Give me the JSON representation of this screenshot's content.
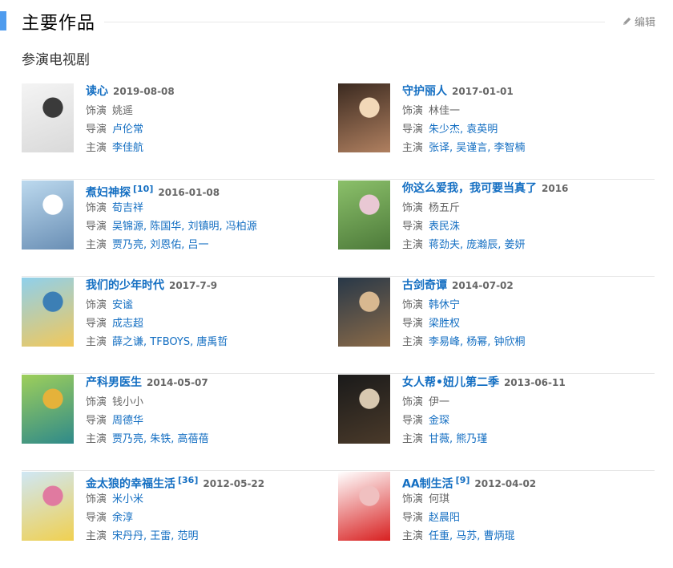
{
  "section": {
    "title": "主要作品",
    "edit_label": "编辑",
    "subtitle": "参演电视剧"
  },
  "labels": {
    "role": "饰演",
    "director": "导演",
    "cast": "主演"
  },
  "works": [
    {
      "title": "读心",
      "ref": "",
      "date": "2019-08-08",
      "role": "姚遥",
      "role_link": false,
      "director": "卢伦常",
      "cast": "李佳航",
      "poster_colors": [
        "#f4f4f4",
        "#d9d9d9",
        "#3a3a3a"
      ]
    },
    {
      "title": "守护丽人",
      "ref": "",
      "date": "2017-01-01",
      "role": "林佳一",
      "role_link": false,
      "director": "朱少杰, 袁英明",
      "cast": "张译, 吴谨言, 李智楠",
      "poster_colors": [
        "#3b2a20",
        "#b08060",
        "#f2d8b8"
      ]
    },
    {
      "title": "煮妇神探",
      "ref": "[10]",
      "date": "2016-01-08",
      "role": "荀吉祥",
      "role_link": true,
      "director": "吴锦源, 陈国华, 刘镇明, 冯柏源",
      "cast": "贾乃亮, 刘恩佑, 吕一",
      "poster_colors": [
        "#bcd9ee",
        "#6a8fb5",
        "#ffffff"
      ]
    },
    {
      "title": "你这么爱我，我可要当真了",
      "ref": "",
      "date": "2016",
      "role": "杨五斤",
      "role_link": false,
      "director": "表民洙",
      "cast": "蒋劲夫, 庞瀚辰, 姜妍",
      "poster_colors": [
        "#8bc06a",
        "#4d7a3a",
        "#e9c8d4"
      ]
    },
    {
      "title": "我们的少年时代",
      "ref": "",
      "date": "2017-7-9",
      "role": "安谧",
      "role_link": true,
      "director": "成志超",
      "cast": "薛之谦, TFBOYS, 唐禹哲",
      "poster_colors": [
        "#8fd0ec",
        "#f2c85a",
        "#3c7fb5"
      ]
    },
    {
      "title": "古剑奇谭",
      "ref": "",
      "date": "2014-07-02",
      "role": "韩休宁",
      "role_link": true,
      "director": "梁胜权",
      "cast": "李易峰, 杨幂, 钟欣桐",
      "poster_colors": [
        "#283848",
        "#8a6a48",
        "#d8b890"
      ]
    },
    {
      "title": "产科男医生",
      "ref": "",
      "date": "2014-05-07",
      "role": "钱小小",
      "role_link": false,
      "director": "周德华",
      "cast": "贾乃亮, 朱铁, 高蓓蓓",
      "poster_colors": [
        "#9ecf5a",
        "#2f8a8a",
        "#e5b23a"
      ]
    },
    {
      "title": "女人帮•妞儿第二季",
      "ref": "",
      "date": "2013-06-11",
      "role": "伊一",
      "role_link": false,
      "director": "金琛",
      "cast": "甘薇, 熊乃瑾",
      "poster_colors": [
        "#1a1a1a",
        "#4a3a2a",
        "#d8c8b0"
      ]
    },
    {
      "title": "金太狼的幸福生活",
      "ref": "[36]",
      "date": "2012-05-22",
      "role": "米小米",
      "role_link": true,
      "director": "余淳",
      "cast": "宋丹丹, 王雷, 范明",
      "poster_colors": [
        "#cfe7f5",
        "#f0d050",
        "#e07aa0"
      ]
    },
    {
      "title": "AA制生活",
      "ref": "[9]",
      "date": "2012-04-02",
      "role": "何琪",
      "role_link": false,
      "director": "赵晨阳",
      "cast": "任重, 马苏, 曹炳琨",
      "poster_colors": [
        "#ffffff",
        "#d82020",
        "#f0c0c0"
      ]
    }
  ]
}
